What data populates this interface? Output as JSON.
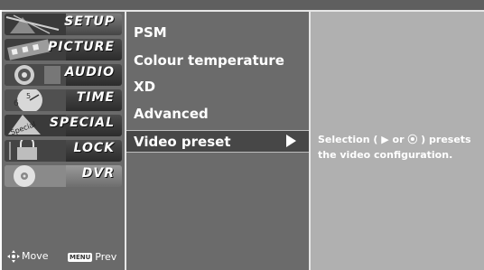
{
  "categories": [
    {
      "label": "SETUP",
      "icon": "setup-icon"
    },
    {
      "label": "PICTURE",
      "icon": "picture-icon"
    },
    {
      "label": "AUDIO",
      "icon": "audio-icon"
    },
    {
      "label": "TIME",
      "icon": "time-icon"
    },
    {
      "label": "SPECIAL",
      "icon": "special-icon"
    },
    {
      "label": "LOCK",
      "icon": "lock-icon"
    },
    {
      "label": "DVR",
      "icon": "dvr-icon"
    }
  ],
  "footer": {
    "move_label": "Move",
    "menu_key": "MENU",
    "prev_label": "Prev"
  },
  "menu_items": [
    "PSM",
    "Colour temperature",
    "XD",
    "Advanced",
    "Video preset"
  ],
  "selected_item": "Video preset",
  "description": "Selection ( ▶ or ⦿ ) presets the video configuration.",
  "colors": {
    "top_bar": "#5f5f5f",
    "left_panel": "#6a6a6a",
    "menu_panel": "#6b6b6b",
    "desc_panel": "#b0b0b0",
    "selection": "#474747",
    "text": "#ffffff"
  }
}
